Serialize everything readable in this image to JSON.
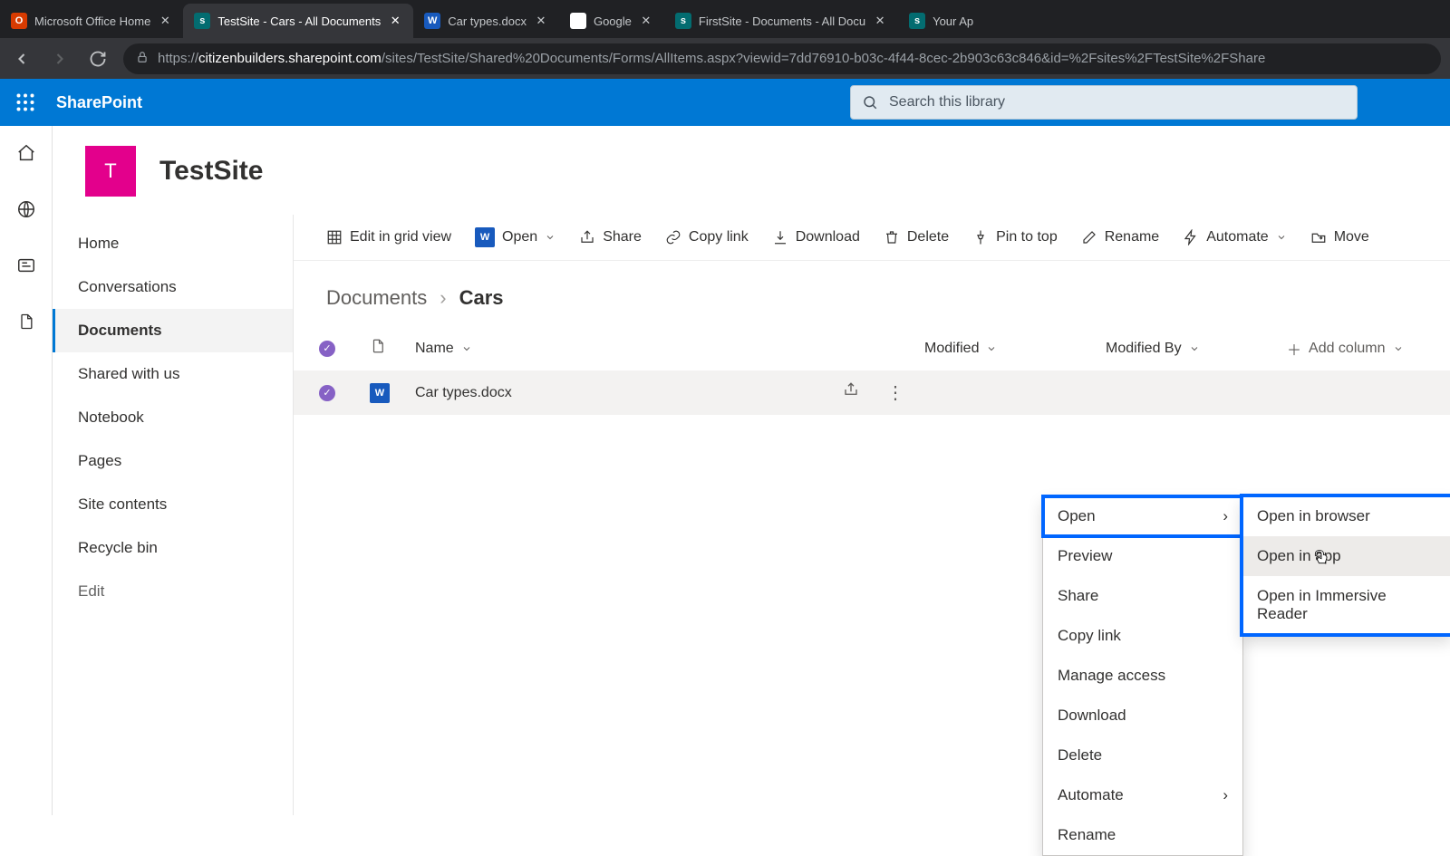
{
  "browser": {
    "tabs": [
      {
        "title": "Microsoft Office Home",
        "fav": "office"
      },
      {
        "title": "TestSite - Cars - All Documents",
        "fav": "sp",
        "active": true
      },
      {
        "title": "Car types.docx",
        "fav": "word"
      },
      {
        "title": "Google",
        "fav": "google"
      },
      {
        "title": "FirstSite - Documents - All Docu",
        "fav": "sp"
      },
      {
        "title": "Your Ap",
        "fav": "sp"
      }
    ],
    "url_prefix": "https://",
    "url_domain": "citizenbuilders.sharepoint.com",
    "url_path": "/sites/TestSite/Shared%20Documents/Forms/AllItems.aspx?viewid=7dd76910-b03c-4f44-8cec-2b903c63c846&id=%2Fsites%2FTestSite%2FShare"
  },
  "suite": {
    "brand": "SharePoint",
    "search_placeholder": "Search this library"
  },
  "site": {
    "logo_letter": "T",
    "title": "TestSite"
  },
  "nav": {
    "items": [
      "Home",
      "Conversations",
      "Documents",
      "Shared with us",
      "Notebook",
      "Pages",
      "Site contents",
      "Recycle bin"
    ],
    "selected_index": 2,
    "edit": "Edit"
  },
  "commandbar": {
    "edit_grid": "Edit in grid view",
    "open": "Open",
    "share": "Share",
    "copy_link": "Copy link",
    "download": "Download",
    "delete": "Delete",
    "pin": "Pin to top",
    "rename": "Rename",
    "automate": "Automate",
    "move": "Move"
  },
  "breadcrumb": {
    "root": "Documents",
    "current": "Cars"
  },
  "columns": {
    "name": "Name",
    "modified": "Modified",
    "modified_by": "Modified By",
    "add": "Add column"
  },
  "row": {
    "filename": "Car types.docx"
  },
  "context_menu": {
    "open": "Open",
    "preview": "Preview",
    "share": "Share",
    "copy_link": "Copy link",
    "manage_access": "Manage access",
    "download": "Download",
    "delete": "Delete",
    "automate": "Automate",
    "rename": "Rename"
  },
  "open_submenu": {
    "browser": "Open in browser",
    "app": "Open in app",
    "immersive": "Open in Immersive Reader"
  }
}
